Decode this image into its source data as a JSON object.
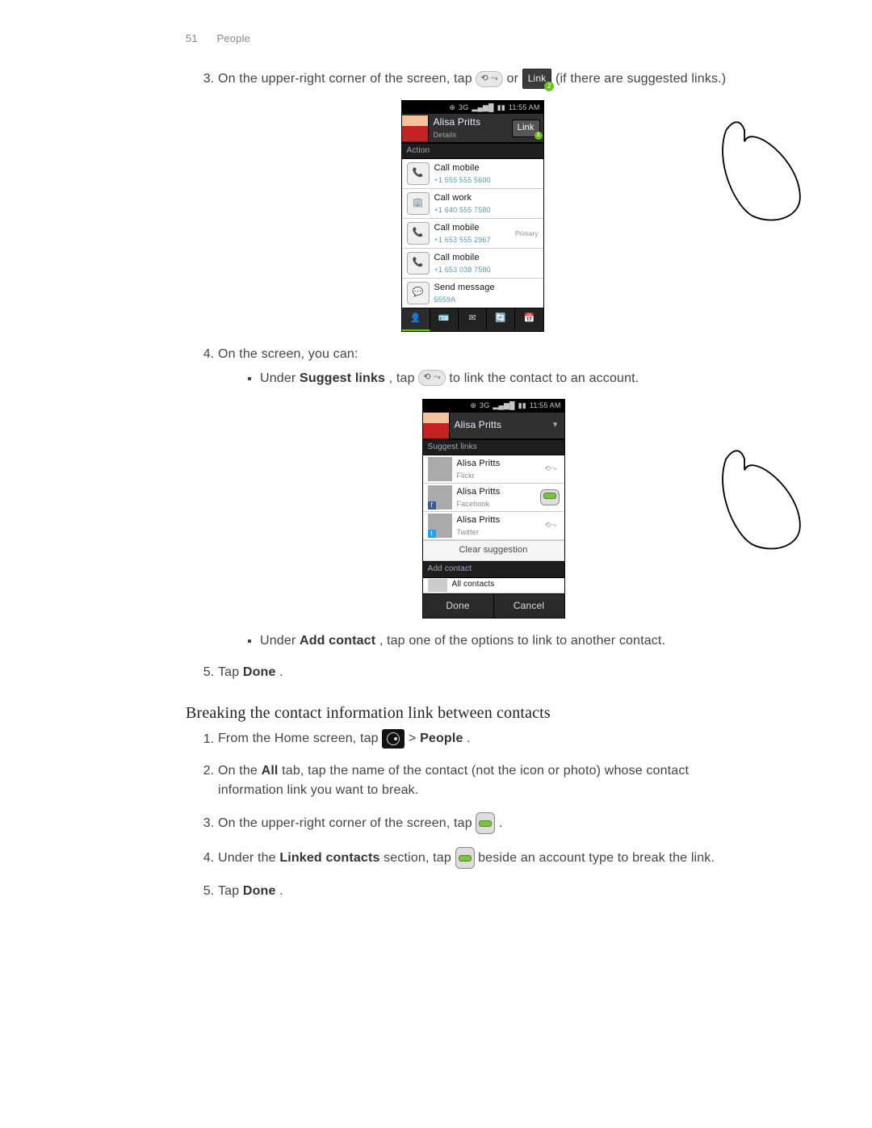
{
  "page_header": {
    "number": "51",
    "section": "People"
  },
  "steps": {
    "s3_a": "On the upper-right corner of the screen, tap ",
    "s3_or": " or ",
    "s3_b": " (if there are suggested links.)",
    "s4": "On the screen, you can:",
    "s4_b1_a": "Under ",
    "s4_b1_bold": "Suggest links",
    "s4_b1_b": ", tap ",
    "s4_b1_c": " to link the contact to an account.",
    "s4_b2_a": "Under ",
    "s4_b2_bold": "Add contact",
    "s4_b2_b": ", tap one of the options to link to another contact.",
    "s5_a": "Tap ",
    "s5_bold": "Done",
    "s5_b": "."
  },
  "inline": {
    "link_btn_label": "Link",
    "link_badge": "2"
  },
  "phone1": {
    "time": "11:55 AM",
    "3g": "3G",
    "name": "Alisa Pritts",
    "subtitle": "Details",
    "link_label": "Link",
    "link_badge": "3",
    "action_header": "Action",
    "rows": [
      {
        "title": "Call mobile",
        "sub": "+1  555 555 5600",
        "tag": ""
      },
      {
        "title": "Call work",
        "sub": "+1 640 555 7580",
        "tag": ""
      },
      {
        "title": "Call mobile",
        "sub": "+1 653 555 2967",
        "tag": "Primary"
      },
      {
        "title": "Call mobile",
        "sub": "+1 653 038 7580",
        "tag": ""
      },
      {
        "title": "Send message",
        "sub": "5559A",
        "tag": ""
      }
    ]
  },
  "phone2": {
    "time": "11:55 AM",
    "3g": "3G",
    "name": "Alisa Pritts",
    "sec_suggest": "Suggest links",
    "rows": [
      {
        "name": "Alisa Pritts",
        "sub": "Flickr",
        "kind": "gray"
      },
      {
        "name": "Alisa Pritts",
        "sub": "Facebook",
        "kind": "green"
      },
      {
        "name": "Alisa Pritts",
        "sub": "Twitter",
        "kind": "gray"
      }
    ],
    "clear": "Clear suggestion",
    "sec_add": "Add contact",
    "all": "All contacts",
    "done": "Done",
    "cancel": "Cancel"
  },
  "section2": {
    "heading": "Breaking the contact information link between contacts",
    "s1_a": "From the Home screen, tap ",
    "s1_b": " > ",
    "s1_bold": "People",
    "s1_c": ".",
    "s2_a": "On the ",
    "s2_bold": "All",
    "s2_b": " tab, tap the name of the contact (not the icon or photo) whose contact information link you want to break.",
    "s3_a": "On the upper-right corner of the screen, tap ",
    "s3_b": ".",
    "s4_a": "Under the ",
    "s4_bold": "Linked contacts",
    "s4_b": " section, tap ",
    "s4_c": " beside an account type to break the link.",
    "s5_a": "Tap ",
    "s5_bold": "Done",
    "s5_b": "."
  }
}
